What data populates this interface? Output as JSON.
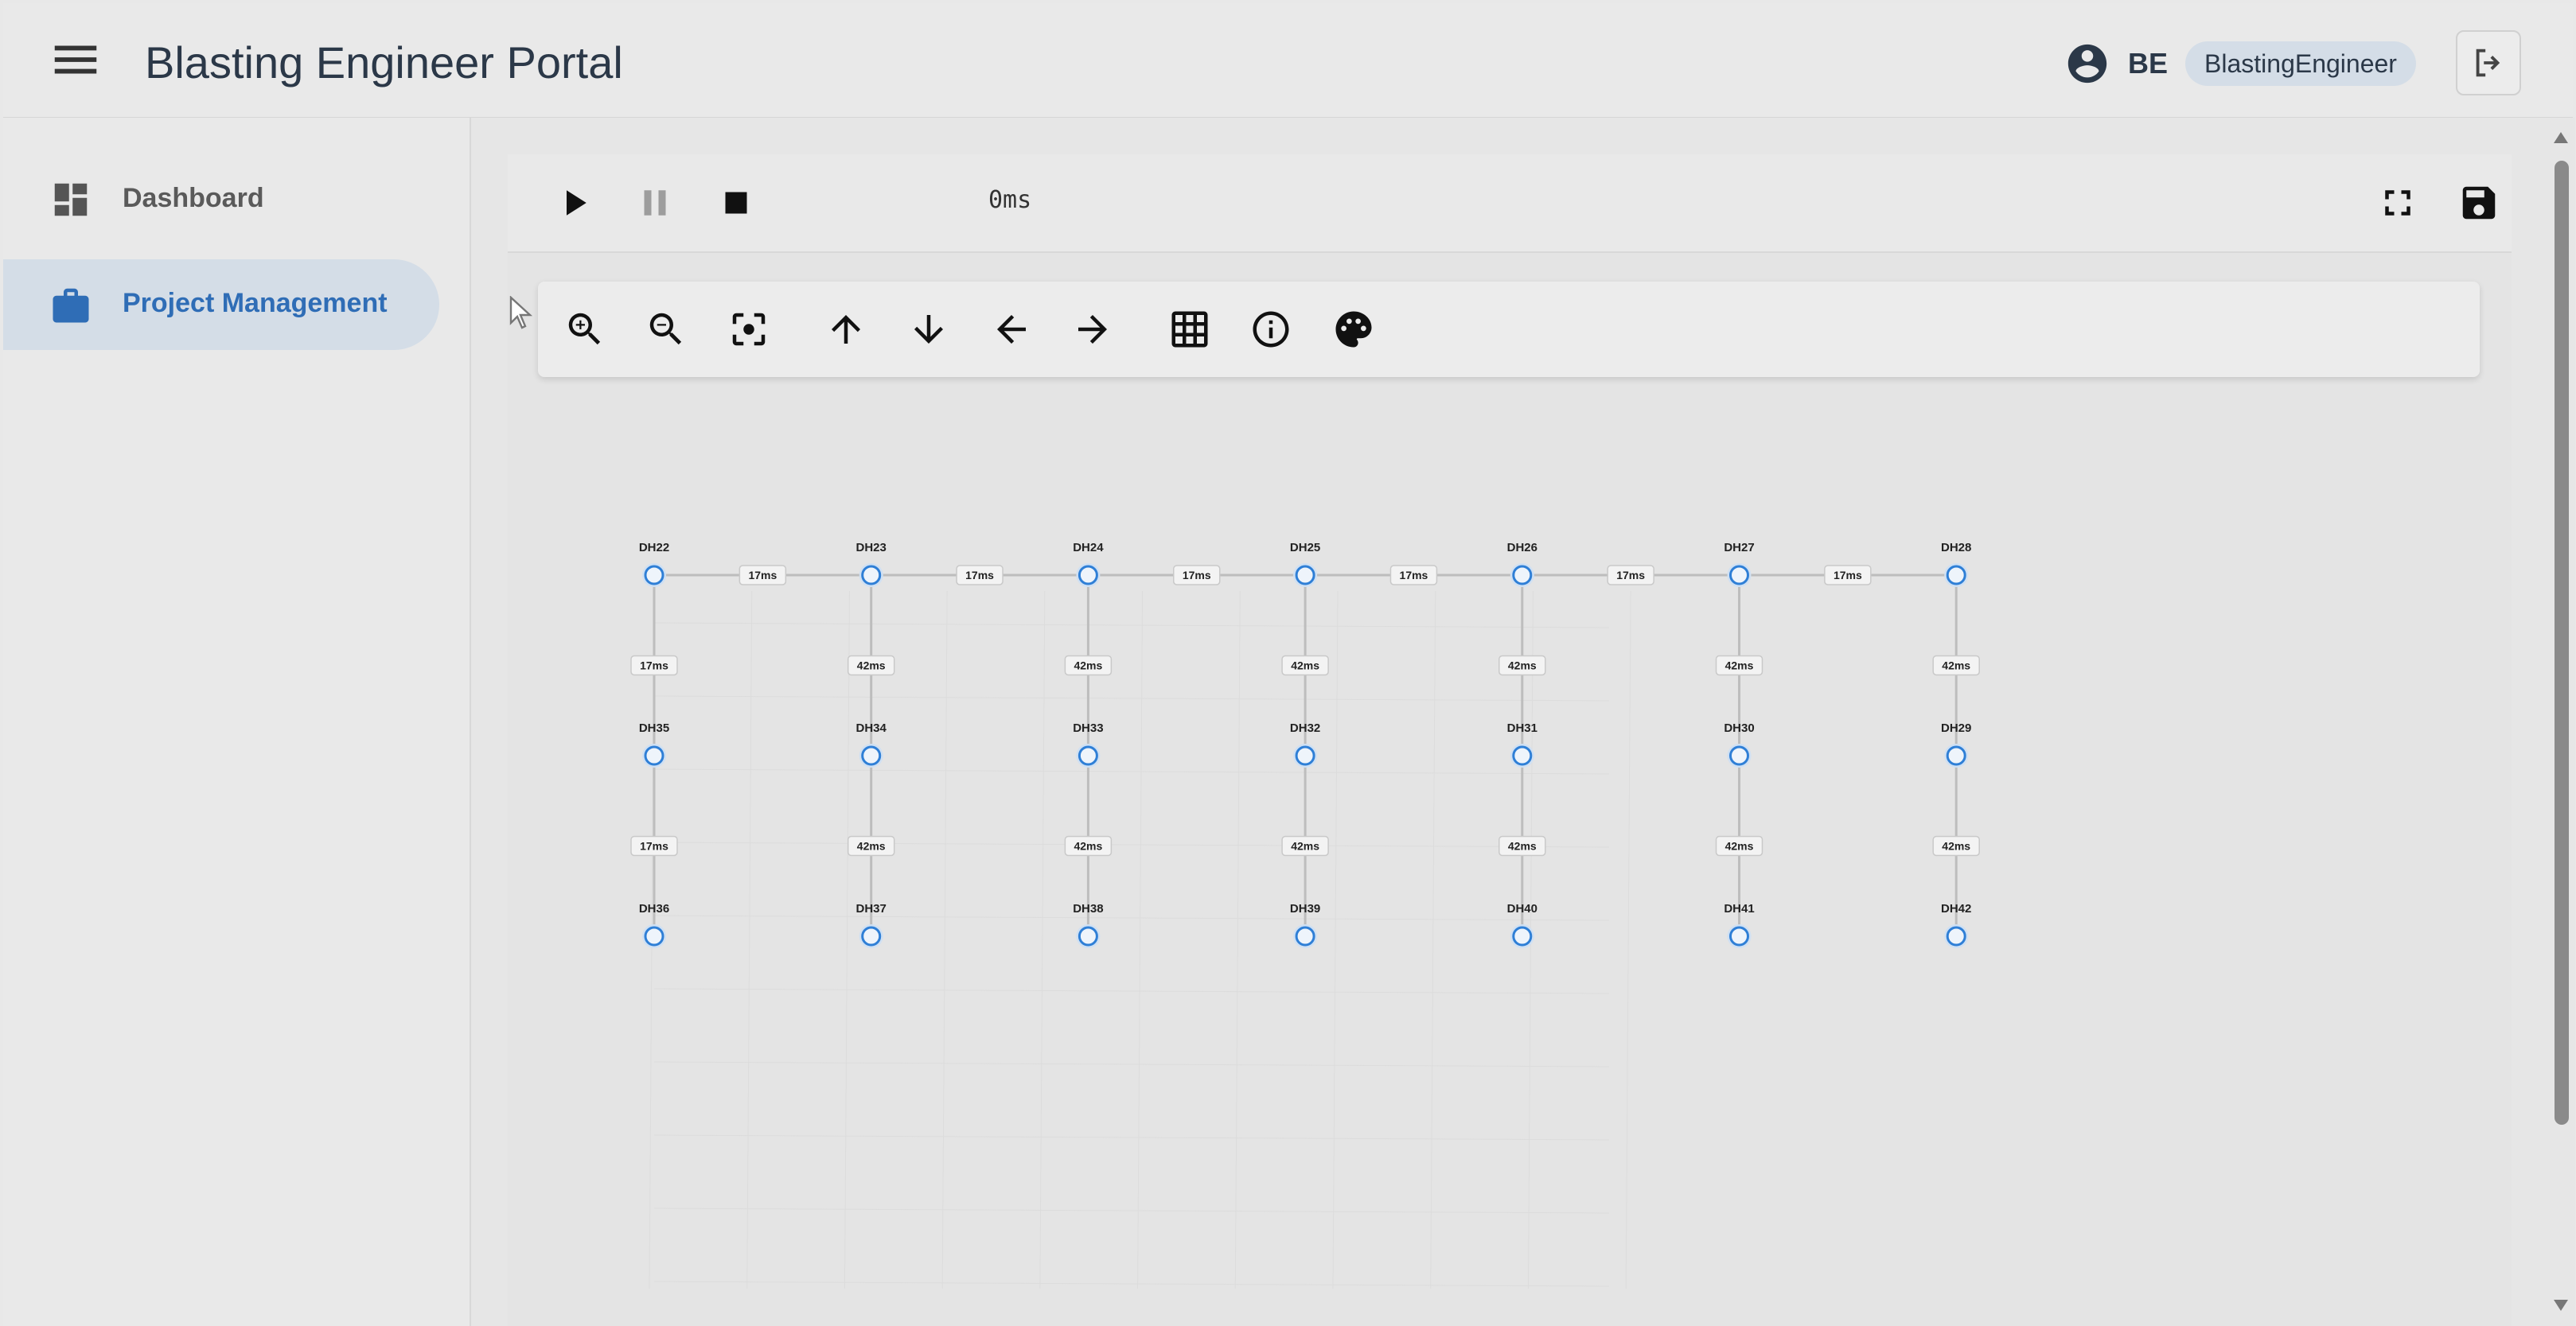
{
  "header": {
    "menu_icon": "menu-icon",
    "title": "Blasting Engineer Portal",
    "user_icon": "account-circle-icon",
    "user_initials": "BE",
    "role": "BlastingEngineer",
    "logout_icon": "logout-icon"
  },
  "sidebar": {
    "items": [
      {
        "label": "Dashboard",
        "icon": "dashboard-icon",
        "active": false
      },
      {
        "label": "Project Management",
        "icon": "briefcase-icon",
        "active": true
      }
    ]
  },
  "player": {
    "time": "0ms",
    "buttons": [
      "play-icon",
      "pause-icon",
      "stop-icon",
      "fullscreen-icon",
      "save-icon"
    ],
    "pause_disabled": true
  },
  "graph_toolbar": {
    "buttons": [
      "zoom-in-icon",
      "zoom-out-icon",
      "center-focus-icon",
      "arrow-up-icon",
      "arrow-down-icon",
      "arrow-left-icon",
      "arrow-right-icon",
      "grid-icon",
      "info-icon",
      "palette-icon"
    ]
  },
  "graph": {
    "rows": [
      [
        "DH22",
        "DH23",
        "DH24",
        "DH25",
        "DH26",
        "DH27",
        "DH28"
      ],
      [
        "DH35",
        "DH34",
        "DH33",
        "DH32",
        "DH31",
        "DH30",
        "DH29"
      ],
      [
        "DH36",
        "DH37",
        "DH38",
        "DH39",
        "DH40",
        "DH41",
        "DH42"
      ]
    ],
    "horizontal_delays": [
      "17ms",
      "17ms",
      "17ms",
      "17ms",
      "17ms",
      "17ms"
    ],
    "vertical_delays": [
      [
        "17ms",
        "42ms",
        "42ms",
        "42ms",
        "42ms",
        "42ms",
        "42ms"
      ],
      [
        "17ms",
        "42ms",
        "42ms",
        "42ms",
        "42ms",
        "42ms",
        "42ms"
      ]
    ],
    "node_color": "#2f7fd6",
    "edge_color": "#bdbdbd"
  }
}
